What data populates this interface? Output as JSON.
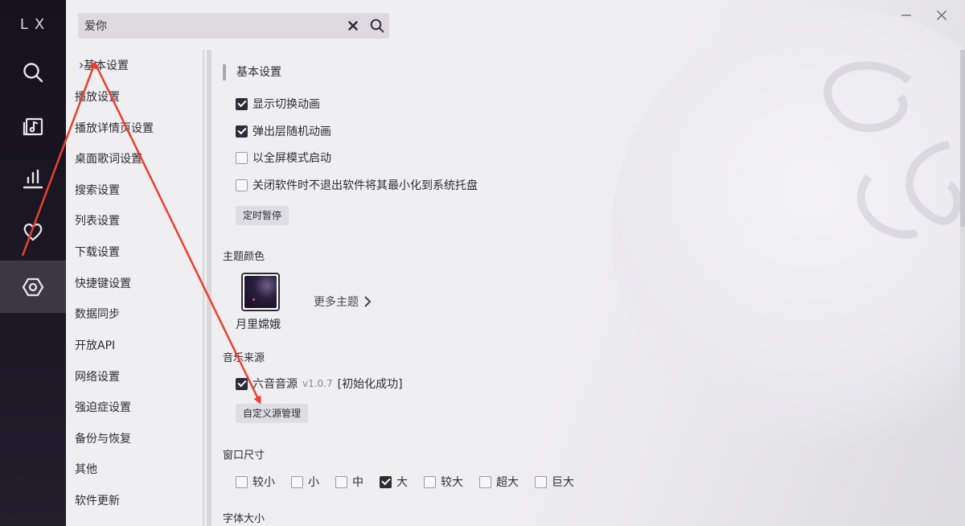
{
  "app": {
    "logo": "LX"
  },
  "rail": {
    "items": [
      {
        "icon": "search-icon"
      },
      {
        "icon": "music-library-icon"
      },
      {
        "icon": "chart-icon"
      },
      {
        "icon": "heart-icon"
      },
      {
        "icon": "settings-icon",
        "active": true
      }
    ]
  },
  "search": {
    "value": "爱你"
  },
  "nav": {
    "items": [
      "基本设置",
      "播放设置",
      "播放详情页设置",
      "桌面歌词设置",
      "搜索设置",
      "列表设置",
      "下载设置",
      "快捷键设置",
      "数据同步",
      "开放API",
      "网络设置",
      "强迫症设置",
      "备份与恢复",
      "其他",
      "软件更新"
    ],
    "active_index": 0
  },
  "content": {
    "basic": {
      "title": "基本设置",
      "options": [
        {
          "label": "显示切换动画",
          "checked": true
        },
        {
          "label": "弹出层随机动画",
          "checked": true
        },
        {
          "label": "以全屏模式启动",
          "checked": false
        },
        {
          "label": "关闭软件时不退出软件将其最小化到系统托盘",
          "checked": false
        }
      ],
      "timer_button": "定时暂停"
    },
    "theme": {
      "title": "主题颜色",
      "current": "月里嫦娥",
      "more": "更多主题"
    },
    "source": {
      "title": "音乐来源",
      "name": "六音音源",
      "version": "v1.0.7",
      "status": "[初始化成功]",
      "checked": true,
      "manage_button": "自定义源管理"
    },
    "window_size": {
      "title": "窗口尺寸",
      "options": [
        {
          "label": "较小",
          "checked": false
        },
        {
          "label": "小",
          "checked": false
        },
        {
          "label": "中",
          "checked": false
        },
        {
          "label": "大",
          "checked": true
        },
        {
          "label": "较大",
          "checked": false
        },
        {
          "label": "超大",
          "checked": false
        },
        {
          "label": "巨大",
          "checked": false
        }
      ]
    },
    "font_size": {
      "title": "字体大小"
    }
  },
  "colors": {
    "accent": "#2f2c39",
    "rail": "#1c1826",
    "annotation": "#e8402f"
  }
}
